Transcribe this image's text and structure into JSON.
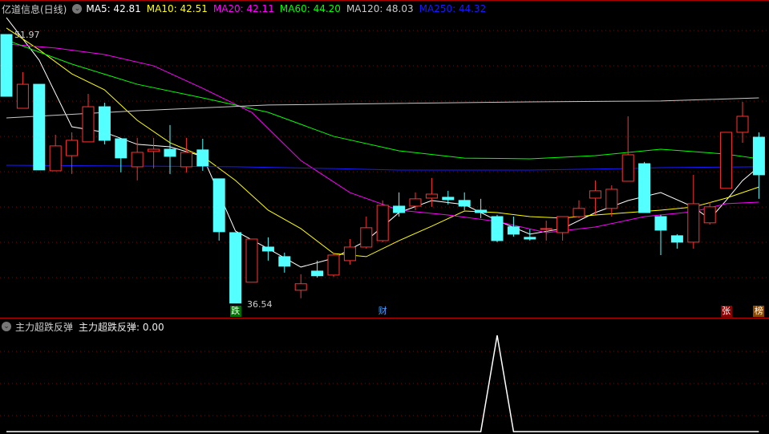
{
  "header": {
    "title": "亿道信息(日线)",
    "ma_labels": [
      {
        "text": "MA5: 42.81",
        "color": "#ffffff"
      },
      {
        "text": "MA10: 42.51",
        "color": "#ffff00"
      },
      {
        "text": "MA20: 42.11",
        "color": "#ff00ff"
      },
      {
        "text": "MA60: 44.20",
        "color": "#00ff00"
      },
      {
        "text": "MA120: 48.03",
        "color": "#c8c8c8"
      },
      {
        "text": "MA250: 44.32",
        "color": "#1a1aff"
      }
    ]
  },
  "indicator_header": {
    "name": "主力超跌反弹",
    "value_label": "主力超跌反弹: 0.00"
  },
  "price_labels": {
    "high": "51.97",
    "low": "36.54"
  },
  "markers": [
    {
      "text": "跌",
      "bar": 14,
      "bg": "#007000",
      "fg": "#ffffff"
    },
    {
      "text": "财",
      "bar": 23,
      "bg": "transparent",
      "fg": "#4aa0ff"
    },
    {
      "text": "张",
      "bar": 44,
      "bg": "#8b0000",
      "fg": "#ffffff"
    },
    {
      "text": "榜",
      "bar": 46,
      "bg": "#8b4a00",
      "fg": "#ffffff"
    }
  ],
  "chart_data": [
    {
      "type": "candlestick",
      "title": "亿道信息(日线)",
      "ylim": [
        36.0,
        52.2
      ],
      "grid": true,
      "up_color": "#ff3232",
      "down_color": "#54ffff",
      "ohlc": [
        [
          51.97,
          48.42,
          51.97,
          48.42
        ],
        [
          47.73,
          49.11,
          49.81,
          47.73
        ],
        [
          49.11,
          44.19,
          49.11,
          44.19
        ],
        [
          44.14,
          45.57,
          46.21,
          44.14
        ],
        [
          45.01,
          45.89,
          46.35,
          43.96
        ],
        [
          45.8,
          47.82,
          48.56,
          45.8
        ],
        [
          47.82,
          45.89,
          48.05,
          45.66
        ],
        [
          45.98,
          44.88,
          45.98,
          44.05
        ],
        [
          44.37,
          45.2,
          46.03,
          43.59
        ],
        [
          45.25,
          45.38,
          46.03,
          44.28
        ],
        [
          45.38,
          44.97,
          46.77,
          43.96
        ],
        [
          44.37,
          45.2,
          46.03,
          44.05
        ],
        [
          45.34,
          44.42,
          45.98,
          44.14
        ],
        [
          43.68,
          40.64,
          43.68,
          40.13
        ],
        [
          40.59,
          36.54,
          40.59,
          36.54
        ],
        [
          37.74,
          40.22,
          40.22,
          37.74
        ],
        [
          39.76,
          39.53,
          40.32,
          38.98
        ],
        [
          39.21,
          38.66,
          39.44,
          38.29
        ],
        [
          37.28,
          37.65,
          38.2,
          36.82
        ],
        [
          38.38,
          38.11,
          38.98,
          38.01
        ],
        [
          38.15,
          39.3,
          39.44,
          38.06
        ],
        [
          38.98,
          39.76,
          40.22,
          38.75
        ],
        [
          39.76,
          40.87,
          41.51,
          39.67
        ],
        [
          40.13,
          42.16,
          42.44,
          40.04
        ],
        [
          42.11,
          41.74,
          42.9,
          41.51
        ],
        [
          42.11,
          42.53,
          42.9,
          41.88
        ],
        [
          42.57,
          42.8,
          43.73,
          42.07
        ],
        [
          42.62,
          42.48,
          42.99,
          42.21
        ],
        [
          42.44,
          42.11,
          42.9,
          41.88
        ],
        [
          41.88,
          41.74,
          42.53,
          41.42
        ],
        [
          41.51,
          40.13,
          41.61,
          40.04
        ],
        [
          40.92,
          40.5,
          41.51,
          40.36
        ],
        [
          40.32,
          40.22,
          40.78,
          40.13
        ],
        [
          40.78,
          40.82,
          41.28,
          40.13
        ],
        [
          40.59,
          41.51,
          41.51,
          40.13
        ],
        [
          41.51,
          41.98,
          42.44,
          41.42
        ],
        [
          42.57,
          42.99,
          43.59,
          41.61
        ],
        [
          41.98,
          43.08,
          43.31,
          41.51
        ],
        [
          43.54,
          45.06,
          47.27,
          43.54
        ],
        [
          44.55,
          41.74,
          44.65,
          41.74
        ],
        [
          41.51,
          40.73,
          41.61,
          39.3
        ],
        [
          40.41,
          40.04,
          40.5,
          39.67
        ],
        [
          40.04,
          42.25,
          43.91,
          39.67
        ],
        [
          41.15,
          42.07,
          42.34,
          41.05
        ],
        [
          43.13,
          46.35,
          46.35,
          43.13
        ],
        [
          46.35,
          47.27,
          48.1,
          45.75
        ],
        [
          46.07,
          43.91,
          46.35,
          42.53
        ]
      ],
      "series": [
        {
          "name": "MA5",
          "color": "#ffffff",
          "points": [
            [
              0,
              52.94
            ],
            [
              2,
              50.5
            ],
            [
              4,
              46.67
            ],
            [
              6,
              46.35
            ],
            [
              8,
              45.66
            ],
            [
              10,
              45.52
            ],
            [
              12,
              44.97
            ],
            [
              14,
              40.68
            ],
            [
              16,
              39.67
            ],
            [
              18,
              38.61
            ],
            [
              20,
              39.12
            ],
            [
              22,
              40.13
            ],
            [
              24,
              41.74
            ],
            [
              26,
              42.43
            ],
            [
              28,
              42.2
            ],
            [
              30,
              41.28
            ],
            [
              32,
              40.5
            ],
            [
              34,
              40.82
            ],
            [
              36,
              41.74
            ],
            [
              38,
              42.43
            ],
            [
              40,
              42.89
            ],
            [
              42,
              42.06
            ],
            [
              43,
              41.37
            ],
            [
              44,
              42.44
            ],
            [
              45,
              43.58
            ],
            [
              46,
              44.37
            ]
          ]
        },
        {
          "name": "MA10",
          "color": "#ffff00",
          "points": [
            [
              0,
              52.34
            ],
            [
              2,
              51.09
            ],
            [
              4,
              49.71
            ],
            [
              6,
              48.79
            ],
            [
              8,
              47.04
            ],
            [
              10,
              45.75
            ],
            [
              12,
              44.97
            ],
            [
              14,
              43.59
            ],
            [
              16,
              41.88
            ],
            [
              18,
              40.82
            ],
            [
              20,
              39.39
            ],
            [
              22,
              39.21
            ],
            [
              24,
              40.13
            ],
            [
              26,
              40.96
            ],
            [
              28,
              41.83
            ],
            [
              30,
              41.74
            ],
            [
              32,
              41.51
            ],
            [
              34,
              41.42
            ],
            [
              36,
              41.6
            ],
            [
              38,
              41.74
            ],
            [
              40,
              41.88
            ],
            [
              42,
              42.06
            ],
            [
              44,
              42.57
            ],
            [
              46,
              43.21
            ]
          ]
        },
        {
          "name": "MA20",
          "color": "#ff00ff",
          "points": [
            [
              0,
              51.42
            ],
            [
              3,
              51.19
            ],
            [
              6,
              50.82
            ],
            [
              9,
              50.17
            ],
            [
              12,
              48.88
            ],
            [
              15,
              47.5
            ],
            [
              18,
              44.73
            ],
            [
              21,
              42.89
            ],
            [
              24,
              41.88
            ],
            [
              27,
              41.6
            ],
            [
              30,
              41.23
            ],
            [
              33,
              40.59
            ],
            [
              36,
              40.91
            ],
            [
              39,
              41.51
            ],
            [
              42,
              41.79
            ],
            [
              44,
              42.25
            ],
            [
              46,
              42.34
            ]
          ]
        },
        {
          "name": "MA60",
          "color": "#00ff00",
          "points": [
            [
              0,
              51.65
            ],
            [
              4,
              50.27
            ],
            [
              8,
              49.11
            ],
            [
              12,
              48.33
            ],
            [
              16,
              47.5
            ],
            [
              20,
              46.12
            ],
            [
              24,
              45.29
            ],
            [
              28,
              44.87
            ],
            [
              32,
              44.83
            ],
            [
              36,
              45.01
            ],
            [
              40,
              45.38
            ],
            [
              44,
              45.1
            ],
            [
              46,
              44.83
            ]
          ]
        },
        {
          "name": "MA120",
          "color": "#c8c8c8",
          "points": [
            [
              0,
              47.18
            ],
            [
              8,
              47.59
            ],
            [
              16,
              47.92
            ],
            [
              24,
              48.01
            ],
            [
              32,
              48.1
            ],
            [
              40,
              48.15
            ],
            [
              46,
              48.33
            ]
          ]
        },
        {
          "name": "MA250",
          "color": "#1a1aff",
          "points": [
            [
              0,
              44.46
            ],
            [
              14,
              44.37
            ],
            [
              20,
              44.27
            ],
            [
              24,
              44.18
            ],
            [
              32,
              44.18
            ],
            [
              38,
              44.27
            ],
            [
              40,
              44.32
            ],
            [
              46,
              44.37
            ]
          ]
        }
      ]
    },
    {
      "type": "line",
      "title": "主力超跌反弹",
      "ylim": [
        0,
        1
      ],
      "color": "#ffffff",
      "points": [
        [
          0,
          0
        ],
        [
          29,
          0
        ],
        [
          30,
          1
        ],
        [
          31,
          0
        ],
        [
          46,
          0
        ]
      ]
    }
  ]
}
